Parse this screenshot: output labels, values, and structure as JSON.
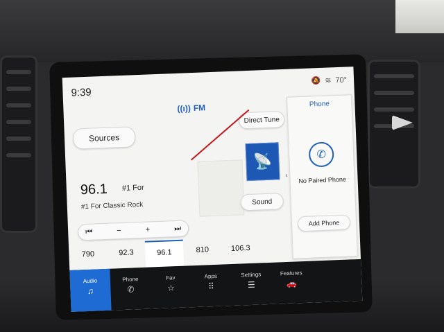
{
  "status": {
    "time": "9:39",
    "temperature": "70°"
  },
  "header": {
    "source_label": "FM"
  },
  "buttons": {
    "sources": "Sources",
    "direct_tune": "Direct Tune",
    "sound": "Sound"
  },
  "station": {
    "frequency": "96.1",
    "name": "#1 For",
    "radio_text": "#1 For Classic Rock"
  },
  "controls": {
    "seek_back": "⏮",
    "minus": "−",
    "plus": "+",
    "seek_forward": "⏭"
  },
  "presets": [
    {
      "label": "790"
    },
    {
      "label": "92.3"
    },
    {
      "label": "96.1",
      "active": true
    },
    {
      "label": "810"
    },
    {
      "label": "106.3"
    }
  ],
  "nav": [
    {
      "label": "Audio",
      "icon": "music-note-icon",
      "active": true
    },
    {
      "label": "Phone",
      "icon": "phone-icon"
    },
    {
      "label": "Fav",
      "icon": "star-icon"
    },
    {
      "label": "Apps",
      "icon": "apps-grid-icon"
    },
    {
      "label": "Settings",
      "icon": "sliders-icon"
    },
    {
      "label": "Features",
      "icon": "car-icon"
    }
  ],
  "phone_panel": {
    "title": "Phone",
    "status": "No Paired Phone",
    "add_button": "Add Phone"
  },
  "colors": {
    "accent": "#1f5fb7",
    "nav_active": "#1e6bd3",
    "nav_bg": "#131416"
  }
}
